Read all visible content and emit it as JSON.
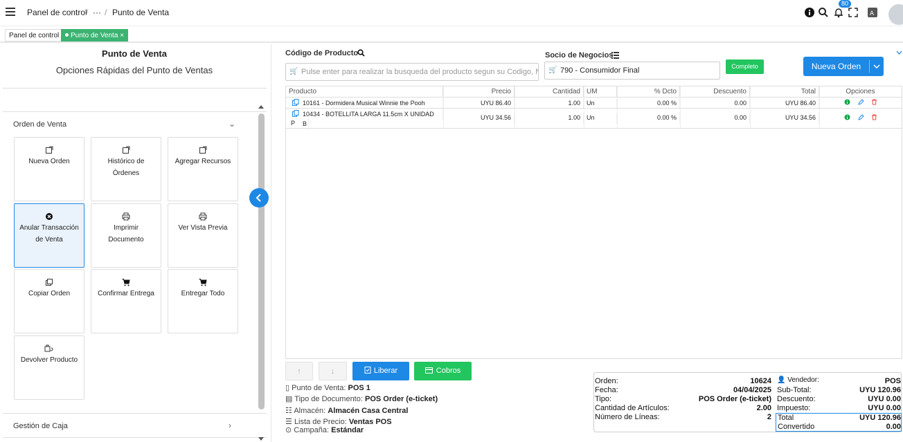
{
  "header": {
    "breadcrumb_home": "Panel de control",
    "breadcrumb_sep1": "/",
    "breadcrumb_more": "···",
    "breadcrumb_sep2": "/",
    "breadcrumb_current": "Punto de Venta",
    "notif_count": "80"
  },
  "tabs": [
    {
      "label": "Panel de control"
    },
    {
      "label": "Punto de Venta",
      "close": "×"
    }
  ],
  "sidebar": {
    "title": "Punto de Venta",
    "subtitle": "Opciones Rápidas del Punto de Ventas",
    "section1": "Orden de Venta",
    "section2": "Gestión de Caja",
    "cards": [
      {
        "icon": "external-link-icon",
        "label": "Nueva Orden"
      },
      {
        "icon": "external-link-icon",
        "label": "Histórico de Órdenes"
      },
      {
        "icon": "external-link-icon",
        "label": "Agregar Recursos"
      },
      {
        "icon": "cancel-icon",
        "label": "Anular Transacción de Venta"
      },
      {
        "icon": "printer-icon",
        "label": "Imprimir Documento"
      },
      {
        "icon": "printer-icon",
        "label": "Ver Vista Previa"
      },
      {
        "icon": "copy-icon",
        "label": "Copiar Orden"
      },
      {
        "icon": "cart-icon",
        "label": "Confirmar Entrega"
      },
      {
        "icon": "cart-icon",
        "label": "Entregar Todo"
      },
      {
        "icon": "return-icon",
        "label": "Devolver Producto"
      }
    ]
  },
  "product": {
    "label": "Código de Producto",
    "placeholder": "Pulse enter para realizar la busqueda del producto segun su Codigo, N"
  },
  "partner": {
    "label": "Socio de Negocios",
    "value": "790 - Consumidor Final",
    "complete_label": "Completo"
  },
  "new_order_label": "Nueva Orden",
  "grid": {
    "columns": [
      "Producto",
      "Precio",
      "Cantidad",
      "UM",
      "% Dcto",
      "Descuento",
      "Total",
      "Opciones"
    ],
    "rows": [
      {
        "product": "10161 - Dormidera Musical Winnie the Pooh",
        "product2": "",
        "price": "UYU 86.40",
        "qty": "1.00",
        "um": "Un",
        "disc_pct": "0.00 %",
        "discount": "0.00",
        "total": "UYU 86.40"
      },
      {
        "product": "10434 - BOTELLITA LARGA 11.5cm X UNIDAD B",
        "product2": "P",
        "price": "UYU 34.56",
        "qty": "1.00",
        "um": "Un",
        "disc_pct": "0.00 %",
        "discount": "0.00",
        "total": "UYU 34.56"
      }
    ]
  },
  "actions": {
    "up": "↑",
    "down": "↓",
    "release": "Liberar",
    "payments": "Cobros"
  },
  "info": {
    "pos_label": "Punto de Venta:",
    "pos_value": "POS 1",
    "doc_label": "Tipo de Documento:",
    "doc_value": "POS Order (e-ticket)",
    "wh_label": "Almacén:",
    "wh_value": "Almacén Casa Central",
    "pl_label": "Lista de Precio:",
    "pl_value": "Ventas POS",
    "camp_label": "Campaña:",
    "camp_value": "Estándar"
  },
  "summary": {
    "order_label": "Orden:",
    "order_value": "10624",
    "date_label": "Fecha:",
    "date_value": "04/04/2025",
    "type_label": "Tipo:",
    "type_value": "POS Order (e-ticket)",
    "items_label": "Cantidad de Artículos:",
    "items_value": "2.00",
    "lines_label": "Número de Líneas:",
    "lines_value": "2",
    "seller_label": "Vendedor:",
    "seller_value": "POS",
    "subtotal_label": "Sub-Total:",
    "subtotal_value": "UYU 120.96",
    "discount_label": "Descuento:",
    "discount_value": "UYU 0.00",
    "tax_label": "Impuesto:",
    "tax_value": "UYU 0.00",
    "total_label": "Total",
    "total_value": "UYU 120.96",
    "converted_label": "Convertido",
    "converted_value": "0.00"
  }
}
